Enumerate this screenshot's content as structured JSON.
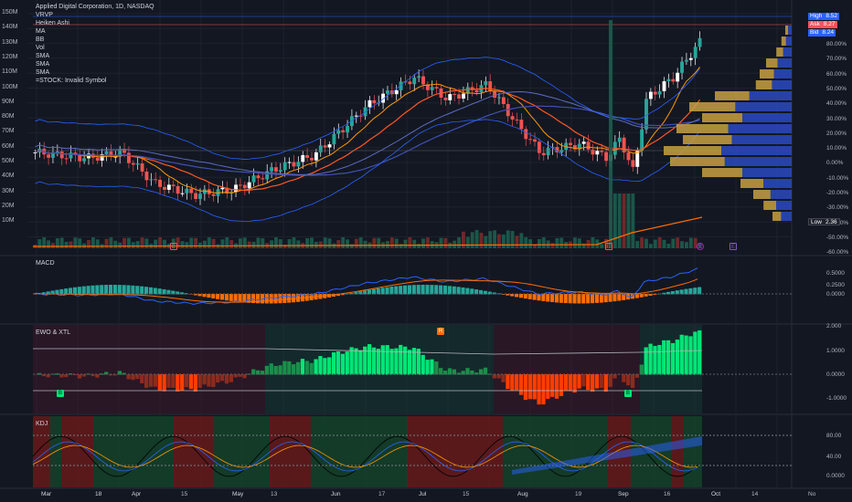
{
  "header": {
    "title": "Applied Digital Corporation, 1D, NASDAQ",
    "indicators": [
      "VRVP",
      "Heiken Ashi",
      "MA",
      "BB",
      "Vol",
      "SMA",
      "SMA",
      "SMA",
      "=STOCK: Invalid Symbol"
    ]
  },
  "left_axis": [
    "150M",
    "140M",
    "130M",
    "120M",
    "110M",
    "100M",
    "90M",
    "80M",
    "70M",
    "60M",
    "50M",
    "40M",
    "30M",
    "20M",
    "10M"
  ],
  "right_axis_main": [
    "80.00%",
    "70.00%",
    "60.00%",
    "50.00%",
    "40.00%",
    "30.00%",
    "20.00%",
    "10.00%",
    "0.00%",
    "-10.00%",
    "-20.00%",
    "-30.00%",
    "-40.00%",
    "-50.00%",
    "-60.00%"
  ],
  "price_tags": [
    {
      "label": "High",
      "value": "8.52",
      "color": "#2962ff"
    },
    {
      "label": "Ask",
      "value": "8.27",
      "color": "#f7525f"
    },
    {
      "label": "Bid",
      "value": "8.24",
      "color": "#2962ff"
    }
  ],
  "low_tag": {
    "label": "Low",
    "value": "2.36"
  },
  "panes": {
    "macd": {
      "label": "MACD",
      "axis": [
        "0.5000",
        "0.2500",
        "0.0000"
      ]
    },
    "ewo": {
      "label": "EWO & XTL",
      "axis": [
        "2.000",
        "1.0000",
        "0.0000",
        "-1.0000"
      ]
    },
    "kdj": {
      "label": "KDJ",
      "axis": [
        "80.00",
        "40.00",
        "0.0000"
      ]
    }
  },
  "dates": [
    "Mar",
    "18",
    "Apr",
    "15",
    "May",
    "13",
    "Jun",
    "17",
    "Jul",
    "15",
    "Aug",
    "19",
    "Sep",
    "16",
    "Oct",
    "14",
    "No"
  ],
  "badges": {
    "earnings": "E",
    "split": "S",
    "ewo_r": "R",
    "ewo_b": "B"
  },
  "colors": {
    "up": "#26a69a",
    "down": "#ef5350",
    "bright_green": "#00e676",
    "orange_red": "#ff3d00",
    "blue": "#2962ff",
    "orange": "#ff6d00",
    "gold": "#c8a041"
  },
  "chart_data": {
    "type": "candlestick",
    "title": "Applied Digital Corporation, 1D, NASDAQ",
    "x": [
      "Mar",
      "18",
      "Apr",
      "15",
      "May",
      "13",
      "Jun",
      "17",
      "Jul",
      "15",
      "Aug",
      "19",
      "Sep",
      "16"
    ],
    "close_pct": [
      -2,
      0,
      -5,
      -40,
      -35,
      -25,
      -10,
      10,
      45,
      50,
      20,
      -5,
      5,
      0,
      65,
      80
    ],
    "ylabel_left": "Volume",
    "ylabel_right": "%",
    "ylim_right": [
      -60,
      80
    ]
  }
}
